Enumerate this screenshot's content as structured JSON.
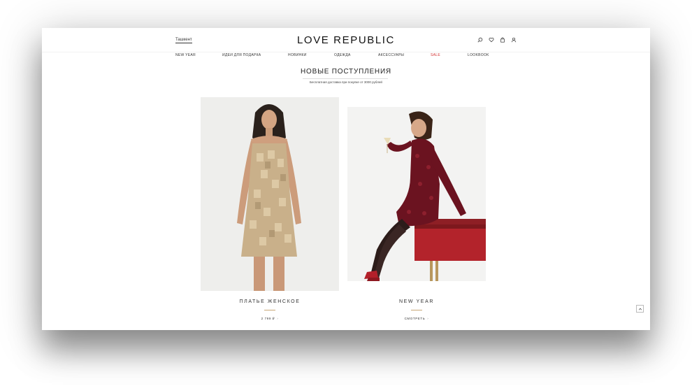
{
  "header": {
    "city": "Ташкент",
    "logo": "LOVE REPUBLIC",
    "icons": [
      "search-icon",
      "heart-icon",
      "bag-icon",
      "user-icon"
    ]
  },
  "nav": [
    {
      "label": "NEW YEAR"
    },
    {
      "label": "ИДЕИ ДЛЯ ПОДАРКА"
    },
    {
      "label": "НОВИНКИ"
    },
    {
      "label": "ОДЕЖДА"
    },
    {
      "label": "АКСЕССУАРЫ"
    },
    {
      "label": "SALE"
    },
    {
      "label": "LOOKBOOK"
    }
  ],
  "section": {
    "title": "НОВЫЕ ПОСТУПЛЕНИЯ",
    "subtitle": "Бесплатная доставка при покупке от 3000 рублей"
  },
  "cards": [
    {
      "name": "ПЛАТЬЕ ЖЕНСКОЕ",
      "link": "2 799 ₽",
      "image": "gold-sequin-dress-photo"
    },
    {
      "name": "NEW YEAR",
      "link": "СМОТРЕТЬ",
      "image": "burgundy-sequin-dress-photo"
    }
  ],
  "colors": {
    "sale": "#d32f2f",
    "accent_line": "#c8a776"
  }
}
